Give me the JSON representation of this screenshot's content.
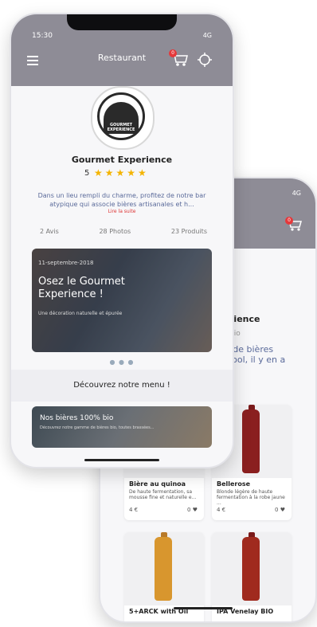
{
  "status": {
    "time": "15:30",
    "network": "4G"
  },
  "header": {
    "title": "Restaurant",
    "cart_badge": "0"
  },
  "restaurant": {
    "name": "Gourmet Experience",
    "logo_text": "GOURMET EXPERIENCE",
    "rating": "5",
    "stars": "★★★★★",
    "description": "Dans un lieu rempli du charme, profitez de notre bar atypique qui associe bières artisanales et h...",
    "read_more": "Lire la suite",
    "stats": {
      "reviews": "2 Avis",
      "photos": "28 Photos",
      "products": "23 Produits"
    }
  },
  "hero": {
    "date": "11-septembre-2018",
    "title": "Osez le Gourmet Experience !",
    "subtitle": "Une décoration naturelle et épurée"
  },
  "carousel_dots": "● ● ●",
  "discover": {
    "label": "Découvrez notre menu !"
  },
  "menu_card": {
    "title": "Nos bières 100% bio",
    "subtitle": "Découvrez notre gamme de bières bio, toutes brassées..."
  },
  "back": {
    "status_network": "4G",
    "cart_badge": "0",
    "peek_title": "rience",
    "peek_sub": "bio",
    "peek_text": "e de bières\nlcool, il y en a",
    "products": [
      {
        "name": "Bière au quinoa",
        "desc": "De haute fermentation, sa mousse fine et naturelle e...",
        "price": "4 €",
        "likes": "0 ♥"
      },
      {
        "name": "Bellerose",
        "desc": "Blonde légère de haute fermentation à la robe jaune ...",
        "price": "4 €",
        "likes": "0 ♥"
      },
      {
        "name": "5+ARCK with Oil",
        "desc": "",
        "price": "",
        "likes": ""
      },
      {
        "name": "IPA Venelay BIO",
        "desc": "",
        "price": "",
        "likes": ""
      }
    ]
  },
  "colors": {
    "header": "#8e8c96",
    "accent_star": "#f4b400",
    "badge": "#e5383b",
    "link": "#5a6a9a"
  }
}
